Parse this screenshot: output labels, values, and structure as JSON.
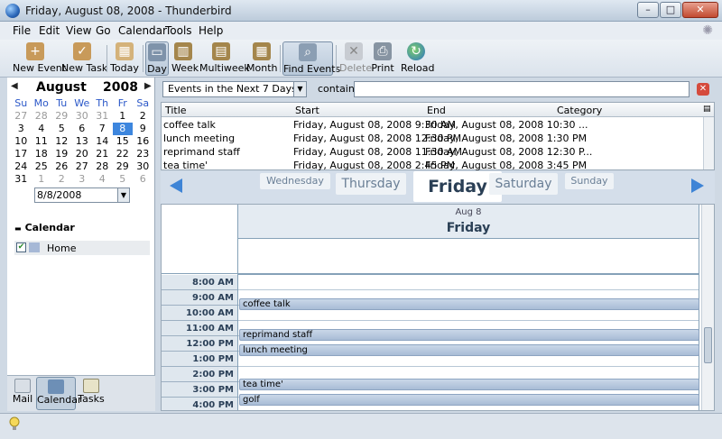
{
  "window": {
    "title": "Friday, August 08, 2008 - Thunderbird",
    "buttons": {
      "minimize": "–",
      "maximize": "□",
      "close": "✕"
    }
  },
  "menu": [
    "File",
    "Edit",
    "View",
    "Go",
    "Calendar",
    "Tools",
    "Help"
  ],
  "toolbar": {
    "new_event": "New Event",
    "new_task": "New Task",
    "today": "Today",
    "day": "Day",
    "week": "Week",
    "multiweek": "Multiweek",
    "month": "Month",
    "find_events": "Find Events",
    "delete": "Delete",
    "print": "Print",
    "reload": "Reload"
  },
  "minicalendar": {
    "month": "August",
    "year": "2008",
    "prev": "◀",
    "next": "▶",
    "days_of_week": [
      "Su",
      "Mo",
      "Tu",
      "We",
      "Th",
      "Fr",
      "Sa"
    ],
    "weeks": [
      [
        "27",
        "28",
        "29",
        "30",
        "31",
        "1",
        "2"
      ],
      [
        "3",
        "4",
        "5",
        "6",
        "7",
        "8",
        "9"
      ],
      [
        "10",
        "11",
        "12",
        "13",
        "14",
        "15",
        "16"
      ],
      [
        "17",
        "18",
        "19",
        "20",
        "21",
        "22",
        "23"
      ],
      [
        "24",
        "25",
        "26",
        "27",
        "28",
        "29",
        "30"
      ],
      [
        "31",
        "1",
        "2",
        "3",
        "4",
        "5",
        "6"
      ]
    ],
    "selected_day": "8",
    "date_field": "8/8/2008"
  },
  "calendars": {
    "heading": "Calendar",
    "items": [
      {
        "name": "Home",
        "checked": true,
        "color": "#a6b8d6"
      }
    ]
  },
  "modes": {
    "mail": "Mail",
    "calendar": "Calendar",
    "tasks": "Tasks"
  },
  "filter": {
    "selected": "Events in the Next 7 Days",
    "contain_label": "contain",
    "search_value": ""
  },
  "event_list": {
    "columns": [
      "Title",
      "Start",
      "End",
      "Category"
    ],
    "rows": [
      {
        "title": "coffee talk",
        "start": "Friday, August 08, 2008 9:30 AM",
        "end": "Friday, August 08, 2008 10:30 ...",
        "category": ""
      },
      {
        "title": "lunch meeting",
        "start": "Friday, August 08, 2008 12:30 PM",
        "end": "Friday, August 08, 2008 1:30 PM",
        "category": ""
      },
      {
        "title": "reprimand staff",
        "start": "Friday, August 08, 2008 11:30 AM",
        "end": "Friday, August 08, 2008 12:30 P...",
        "category": ""
      },
      {
        "title": "tea time'",
        "start": "Friday, August 08, 2008 2:45 PM",
        "end": "Friday, August 08, 2008 3:45 PM",
        "category": ""
      }
    ]
  },
  "day_nav": {
    "wednesday": "Wednesday",
    "thursday": "Thursday",
    "friday": "Friday",
    "saturday": "Saturday",
    "sunday": "Sunday"
  },
  "day_view": {
    "date_label": "Aug 8",
    "day_label": "Friday",
    "hours": [
      "8:00 AM",
      "9:00 AM",
      "10:00 AM",
      "11:00 AM",
      "12:00 PM",
      "1:00 PM",
      "2:00 PM",
      "3:00 PM",
      "4:00 PM"
    ],
    "events": {
      "coffee": "coffee talk",
      "reprimand": "reprimand staff",
      "lunch": "lunch meeting",
      "tea": "tea time'",
      "golf": "golf"
    }
  },
  "colors": {
    "accent": "#3d86de",
    "event_fill": "#b4c6dd",
    "calendar_home": "#a6b8d6"
  },
  "icons": [
    "app-icon",
    "new-event-icon",
    "new-task-icon",
    "today-icon",
    "day-icon",
    "week-icon",
    "multiweek-icon",
    "month-icon",
    "find-events-icon",
    "delete-icon",
    "print-icon",
    "reload-icon",
    "mail-icon",
    "calendar-icon",
    "tasks-icon",
    "clear-search-icon",
    "column-picker-icon",
    "bulb-icon"
  ]
}
